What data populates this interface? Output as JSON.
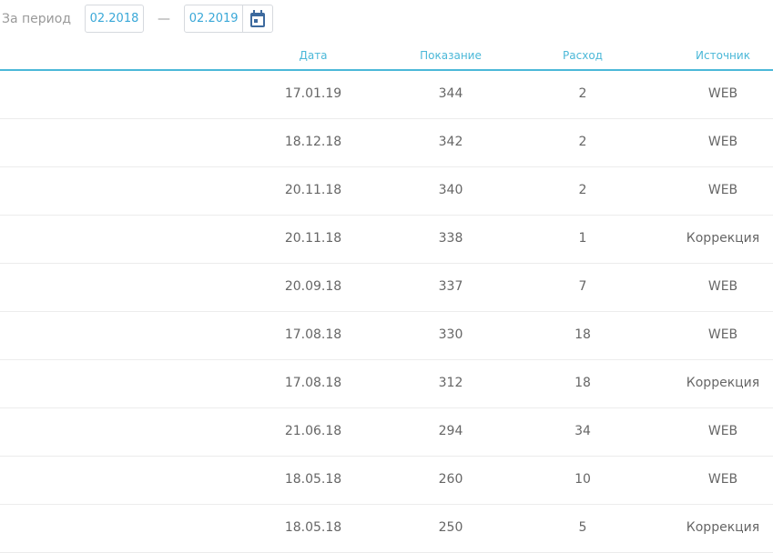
{
  "filter": {
    "label": "За период",
    "from": "02.2018",
    "separator": "—",
    "to": "02.2019"
  },
  "columns": [
    "Дата",
    "Показание",
    "Расход",
    "Источник"
  ],
  "rows": [
    [
      "17.01.19",
      "344",
      "2",
      "WEB"
    ],
    [
      "18.12.18",
      "342",
      "2",
      "WEB"
    ],
    [
      "20.11.18",
      "340",
      "2",
      "WEB"
    ],
    [
      "20.11.18",
      "338",
      "1",
      "Коррекция"
    ],
    [
      "20.09.18",
      "337",
      "7",
      "WEB"
    ],
    [
      "17.08.18",
      "330",
      "18",
      "WEB"
    ],
    [
      "17.08.18",
      "312",
      "18",
      "Коррекция"
    ],
    [
      "21.06.18",
      "294",
      "34",
      "WEB"
    ],
    [
      "18.05.18",
      "260",
      "10",
      "WEB"
    ],
    [
      "18.05.18",
      "250",
      "5",
      "Коррекция"
    ]
  ],
  "colors": {
    "accent": "#4bb8d8",
    "calendar": "#3d6a9e"
  }
}
